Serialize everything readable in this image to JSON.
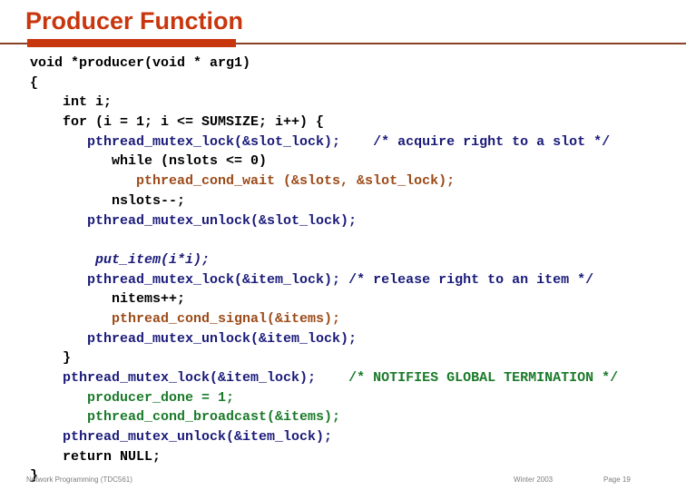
{
  "slide": {
    "title": "Producer Function",
    "accent_color": "#c8360d",
    "rule_color": "#8a4226"
  },
  "colors": {
    "code_black": "#000000",
    "code_navy": "#1a1a7a",
    "code_green": "#1a7a29",
    "code_brown": "#9c4a18"
  },
  "code": {
    "language": "c",
    "lines": [
      {
        "indent": 0,
        "segments": [
          {
            "text": "void *producer(void * arg1)",
            "color": "black"
          }
        ]
      },
      {
        "indent": 0,
        "segments": [
          {
            "text": "{",
            "color": "black"
          }
        ]
      },
      {
        "indent": 0,
        "segments": [
          {
            "text": "    int i;",
            "color": "black"
          }
        ]
      },
      {
        "indent": 0,
        "segments": [
          {
            "text": "    for (i = 1; i <= SUMSIZE; i++) {",
            "color": "black"
          }
        ]
      },
      {
        "indent": 0,
        "segments": [
          {
            "text": "       pthread_mutex_lock(&slot_lock);",
            "color": "navy"
          },
          {
            "text": "    /* acquire right to a slot */",
            "color": "navy"
          }
        ]
      },
      {
        "indent": 0,
        "segments": [
          {
            "text": "          while (nslots <= 0)",
            "color": "black"
          }
        ]
      },
      {
        "indent": 0,
        "segments": [
          {
            "text": "             pthread_cond_wait (&slots, &slot_lock);",
            "color": "brown"
          }
        ]
      },
      {
        "indent": 0,
        "segments": [
          {
            "text": "          nslots--;",
            "color": "black"
          }
        ]
      },
      {
        "indent": 0,
        "segments": [
          {
            "text": "       pthread_mutex_unlock(&slot_lock);",
            "color": "navy"
          }
        ]
      },
      {
        "indent": 0,
        "segments": [
          {
            "text": "",
            "color": "black"
          }
        ]
      },
      {
        "indent": 0,
        "segments": [
          {
            "text": "        put_item(i*i);",
            "color": "blue-italic"
          }
        ]
      },
      {
        "indent": 0,
        "segments": [
          {
            "text": "       pthread_mutex_lock(&item_lock);",
            "color": "navy"
          },
          {
            "text": " /* release right to an item */",
            "color": "navy"
          }
        ]
      },
      {
        "indent": 0,
        "segments": [
          {
            "text": "          nitems++;",
            "color": "black"
          }
        ]
      },
      {
        "indent": 0,
        "segments": [
          {
            "text": "          pthread_cond_signal(&items);",
            "color": "brown"
          }
        ]
      },
      {
        "indent": 0,
        "segments": [
          {
            "text": "       pthread_mutex_unlock(&item_lock);",
            "color": "navy"
          }
        ]
      },
      {
        "indent": 0,
        "segments": [
          {
            "text": "    }",
            "color": "black"
          }
        ]
      },
      {
        "indent": 0,
        "segments": [
          {
            "text": "    pthread_mutex_lock(&item_lock);",
            "color": "navy"
          },
          {
            "text": "    /* NOTIFIES GLOBAL TERMINATION */",
            "color": "green"
          }
        ]
      },
      {
        "indent": 0,
        "segments": [
          {
            "text": "       producer_done = 1;",
            "color": "green"
          }
        ]
      },
      {
        "indent": 0,
        "segments": [
          {
            "text": "       pthread_cond_broadcast(&items);",
            "color": "green"
          }
        ]
      },
      {
        "indent": 0,
        "segments": [
          {
            "text": "    pthread_mutex_unlock(&item_lock);",
            "color": "navy"
          }
        ]
      },
      {
        "indent": 0,
        "segments": [
          {
            "text": "    return NULL;",
            "color": "black"
          }
        ]
      },
      {
        "indent": 0,
        "segments": [
          {
            "text": "}",
            "color": "black"
          }
        ]
      }
    ]
  },
  "footer": {
    "course": "Network Programming (TDC561)",
    "term": "Winter  2003",
    "page": "Page 19"
  }
}
